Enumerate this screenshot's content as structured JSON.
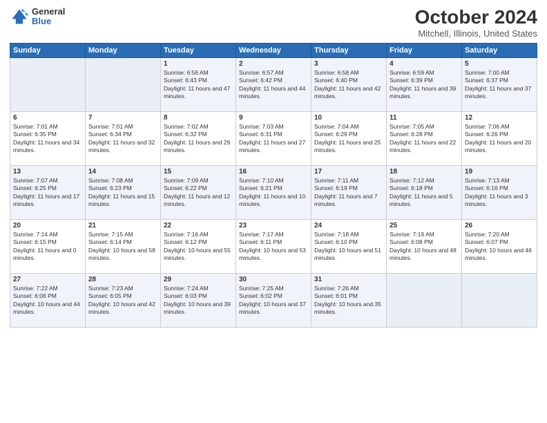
{
  "logo": {
    "general": "General",
    "blue": "Blue"
  },
  "header": {
    "title": "October 2024",
    "subtitle": "Mitchell, Illinois, United States"
  },
  "weekdays": [
    "Sunday",
    "Monday",
    "Tuesday",
    "Wednesday",
    "Thursday",
    "Friday",
    "Saturday"
  ],
  "weeks": [
    [
      {
        "day": "",
        "detail": ""
      },
      {
        "day": "",
        "detail": ""
      },
      {
        "day": "1",
        "detail": "Sunrise: 6:56 AM\nSunset: 6:43 PM\nDaylight: 11 hours and 47 minutes."
      },
      {
        "day": "2",
        "detail": "Sunrise: 6:57 AM\nSunset: 6:42 PM\nDaylight: 11 hours and 44 minutes."
      },
      {
        "day": "3",
        "detail": "Sunrise: 6:58 AM\nSunset: 6:40 PM\nDaylight: 11 hours and 42 minutes."
      },
      {
        "day": "4",
        "detail": "Sunrise: 6:59 AM\nSunset: 6:39 PM\nDaylight: 11 hours and 39 minutes."
      },
      {
        "day": "5",
        "detail": "Sunrise: 7:00 AM\nSunset: 6:37 PM\nDaylight: 11 hours and 37 minutes."
      }
    ],
    [
      {
        "day": "6",
        "detail": "Sunrise: 7:01 AM\nSunset: 6:35 PM\nDaylight: 11 hours and 34 minutes."
      },
      {
        "day": "7",
        "detail": "Sunrise: 7:01 AM\nSunset: 6:34 PM\nDaylight: 11 hours and 32 minutes."
      },
      {
        "day": "8",
        "detail": "Sunrise: 7:02 AM\nSunset: 6:32 PM\nDaylight: 11 hours and 29 minutes."
      },
      {
        "day": "9",
        "detail": "Sunrise: 7:03 AM\nSunset: 6:31 PM\nDaylight: 11 hours and 27 minutes."
      },
      {
        "day": "10",
        "detail": "Sunrise: 7:04 AM\nSunset: 6:29 PM\nDaylight: 11 hours and 25 minutes."
      },
      {
        "day": "11",
        "detail": "Sunrise: 7:05 AM\nSunset: 6:28 PM\nDaylight: 11 hours and 22 minutes."
      },
      {
        "day": "12",
        "detail": "Sunrise: 7:06 AM\nSunset: 6:26 PM\nDaylight: 11 hours and 20 minutes."
      }
    ],
    [
      {
        "day": "13",
        "detail": "Sunrise: 7:07 AM\nSunset: 6:25 PM\nDaylight: 11 hours and 17 minutes."
      },
      {
        "day": "14",
        "detail": "Sunrise: 7:08 AM\nSunset: 6:23 PM\nDaylight: 11 hours and 15 minutes."
      },
      {
        "day": "15",
        "detail": "Sunrise: 7:09 AM\nSunset: 6:22 PM\nDaylight: 11 hours and 12 minutes."
      },
      {
        "day": "16",
        "detail": "Sunrise: 7:10 AM\nSunset: 6:21 PM\nDaylight: 11 hours and 10 minutes."
      },
      {
        "day": "17",
        "detail": "Sunrise: 7:11 AM\nSunset: 6:19 PM\nDaylight: 11 hours and 7 minutes."
      },
      {
        "day": "18",
        "detail": "Sunrise: 7:12 AM\nSunset: 6:18 PM\nDaylight: 11 hours and 5 minutes."
      },
      {
        "day": "19",
        "detail": "Sunrise: 7:13 AM\nSunset: 6:16 PM\nDaylight: 11 hours and 3 minutes."
      }
    ],
    [
      {
        "day": "20",
        "detail": "Sunrise: 7:14 AM\nSunset: 6:15 PM\nDaylight: 11 hours and 0 minutes."
      },
      {
        "day": "21",
        "detail": "Sunrise: 7:15 AM\nSunset: 6:14 PM\nDaylight: 10 hours and 58 minutes."
      },
      {
        "day": "22",
        "detail": "Sunrise: 7:16 AM\nSunset: 6:12 PM\nDaylight: 10 hours and 55 minutes."
      },
      {
        "day": "23",
        "detail": "Sunrise: 7:17 AM\nSunset: 6:11 PM\nDaylight: 10 hours and 53 minutes."
      },
      {
        "day": "24",
        "detail": "Sunrise: 7:18 AM\nSunset: 6:10 PM\nDaylight: 10 hours and 51 minutes."
      },
      {
        "day": "25",
        "detail": "Sunrise: 7:19 AM\nSunset: 6:08 PM\nDaylight: 10 hours and 48 minutes."
      },
      {
        "day": "26",
        "detail": "Sunrise: 7:20 AM\nSunset: 6:07 PM\nDaylight: 10 hours and 46 minutes."
      }
    ],
    [
      {
        "day": "27",
        "detail": "Sunrise: 7:22 AM\nSunset: 6:06 PM\nDaylight: 10 hours and 44 minutes."
      },
      {
        "day": "28",
        "detail": "Sunrise: 7:23 AM\nSunset: 6:05 PM\nDaylight: 10 hours and 42 minutes."
      },
      {
        "day": "29",
        "detail": "Sunrise: 7:24 AM\nSunset: 6:03 PM\nDaylight: 10 hours and 39 minutes."
      },
      {
        "day": "30",
        "detail": "Sunrise: 7:25 AM\nSunset: 6:02 PM\nDaylight: 10 hours and 37 minutes."
      },
      {
        "day": "31",
        "detail": "Sunrise: 7:26 AM\nSunset: 6:01 PM\nDaylight: 10 hours and 35 minutes."
      },
      {
        "day": "",
        "detail": ""
      },
      {
        "day": "",
        "detail": ""
      }
    ]
  ]
}
